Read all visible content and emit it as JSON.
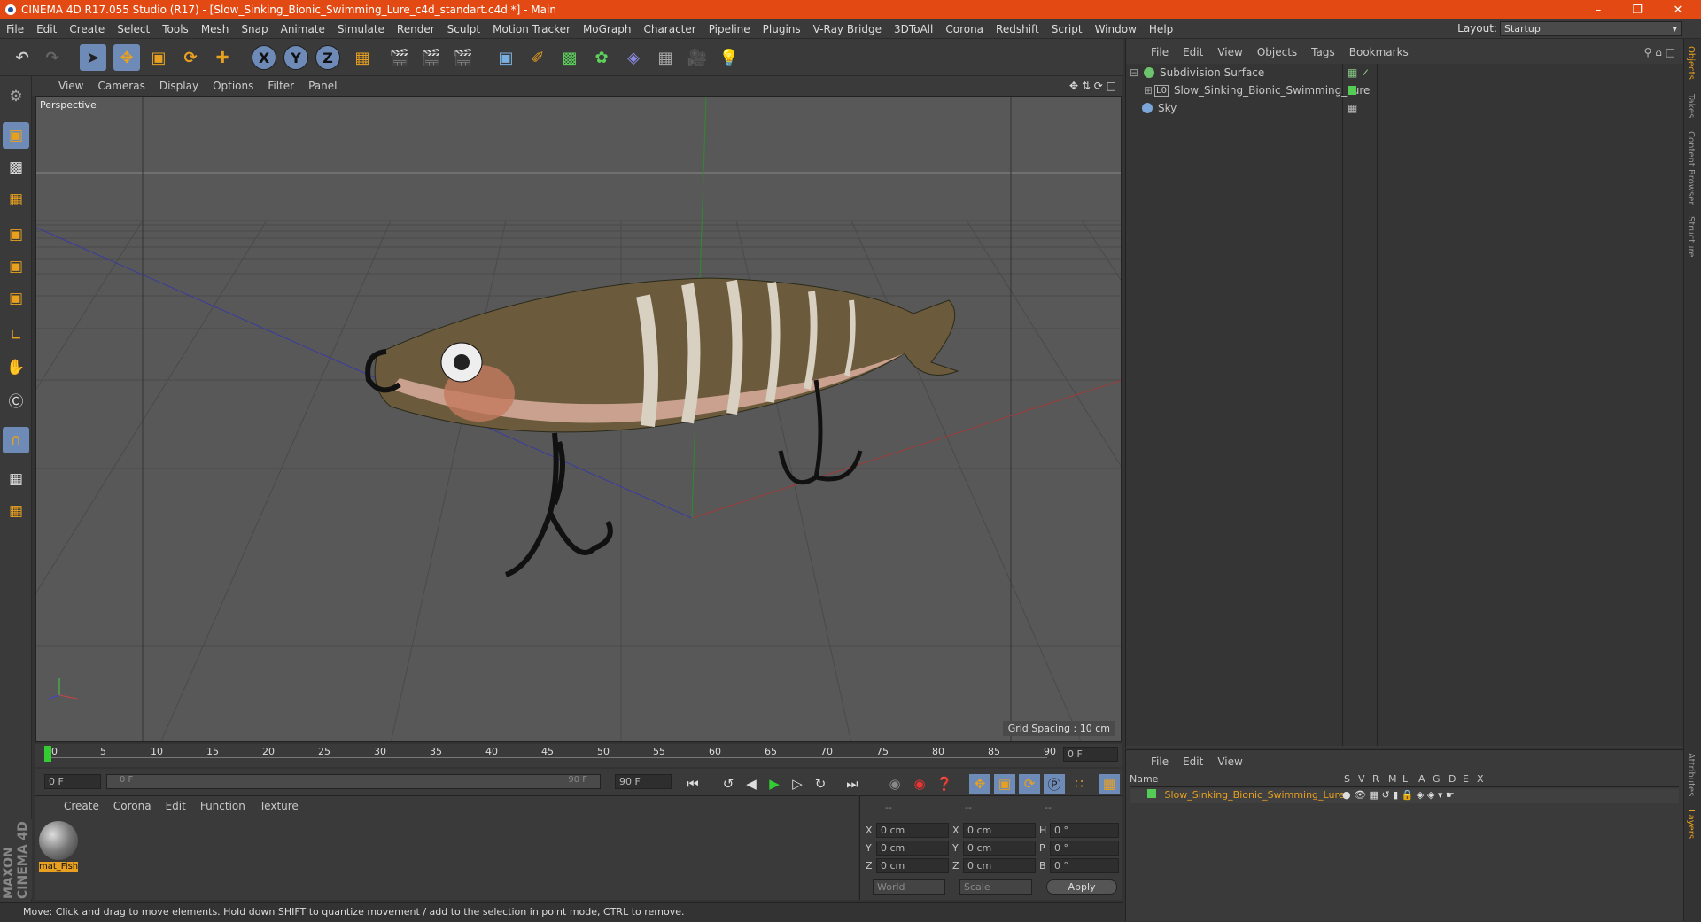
{
  "window": {
    "title": "CINEMA 4D R17.055 Studio (R17) - [Slow_Sinking_Bionic_Swimming_Lure_c4d_standart.c4d *] - Main"
  },
  "menubar": [
    "File",
    "Edit",
    "Create",
    "Select",
    "Tools",
    "Mesh",
    "Snap",
    "Animate",
    "Simulate",
    "Render",
    "Sculpt",
    "Motion Tracker",
    "MoGraph",
    "Character",
    "Pipeline",
    "Plugins",
    "V-Ray Bridge",
    "3DToAll",
    "Corona",
    "Redshift",
    "Script",
    "Window",
    "Help"
  ],
  "layout": {
    "label": "Layout:",
    "value": "Startup"
  },
  "toolbar": {
    "axis_x": "X",
    "axis_y": "Y",
    "axis_z": "Z"
  },
  "viewport": {
    "menu": [
      "View",
      "Cameras",
      "Display",
      "Options",
      "Filter",
      "Panel"
    ],
    "label": "Perspective",
    "grid_spacing": "Grid Spacing : 10 cm"
  },
  "object_manager": {
    "menu": [
      "File",
      "Edit",
      "View",
      "Objects",
      "Tags",
      "Bookmarks"
    ],
    "objects": [
      {
        "name": "Subdivision Surface",
        "color": "#6ec36e"
      },
      {
        "name": "Slow_Sinking_Bionic_Swimming_Lure",
        "color": "#ddd"
      },
      {
        "name": "Sky",
        "color": "#7aa7d8"
      }
    ]
  },
  "side_tabs": [
    "Objects",
    "Takes",
    "Content Browser",
    "Structure"
  ],
  "side_tabs_bottom": [
    "Attributes",
    "Layers"
  ],
  "layer_manager": {
    "menu": [
      "File",
      "Edit",
      "View"
    ],
    "columns": [
      "Name",
      "S",
      "V",
      "R",
      "M",
      "L",
      "A",
      "G",
      "D",
      "E",
      "X"
    ],
    "layer": "Slow_Sinking_Bionic_Swimming_Lure"
  },
  "timeline": {
    "ticks": [
      "0",
      "5",
      "10",
      "15",
      "20",
      "25",
      "30",
      "35",
      "40",
      "45",
      "50",
      "55",
      "60",
      "65",
      "70",
      "75",
      "80",
      "85",
      "90"
    ],
    "current_frame": "0 F",
    "start": "0 F",
    "slider_start": "0 F",
    "slider_end": "90 F",
    "end": "90 F"
  },
  "material_manager": {
    "menu": [
      "Create",
      "Corona",
      "Edit",
      "Function",
      "Texture"
    ],
    "material": "mat_Fish"
  },
  "coordinates": {
    "header": [
      "--",
      "--",
      "--"
    ],
    "rows": [
      {
        "a": "X",
        "av": "0 cm",
        "b": "X",
        "bv": "0 cm",
        "c": "H",
        "cv": "0 °"
      },
      {
        "a": "Y",
        "av": "0 cm",
        "b": "Y",
        "bv": "0 cm",
        "c": "P",
        "cv": "0 °"
      },
      {
        "a": "Z",
        "av": "0 cm",
        "b": "Z",
        "bv": "0 cm",
        "c": "B",
        "cv": "0 °"
      }
    ],
    "world": "World",
    "scale": "Scale",
    "apply": "Apply"
  },
  "status": "Move: Click and drag to move elements. Hold down SHIFT to quantize movement / add to the selection in point mode, CTRL to remove.",
  "branding": "MAXON CINEMA 4D"
}
